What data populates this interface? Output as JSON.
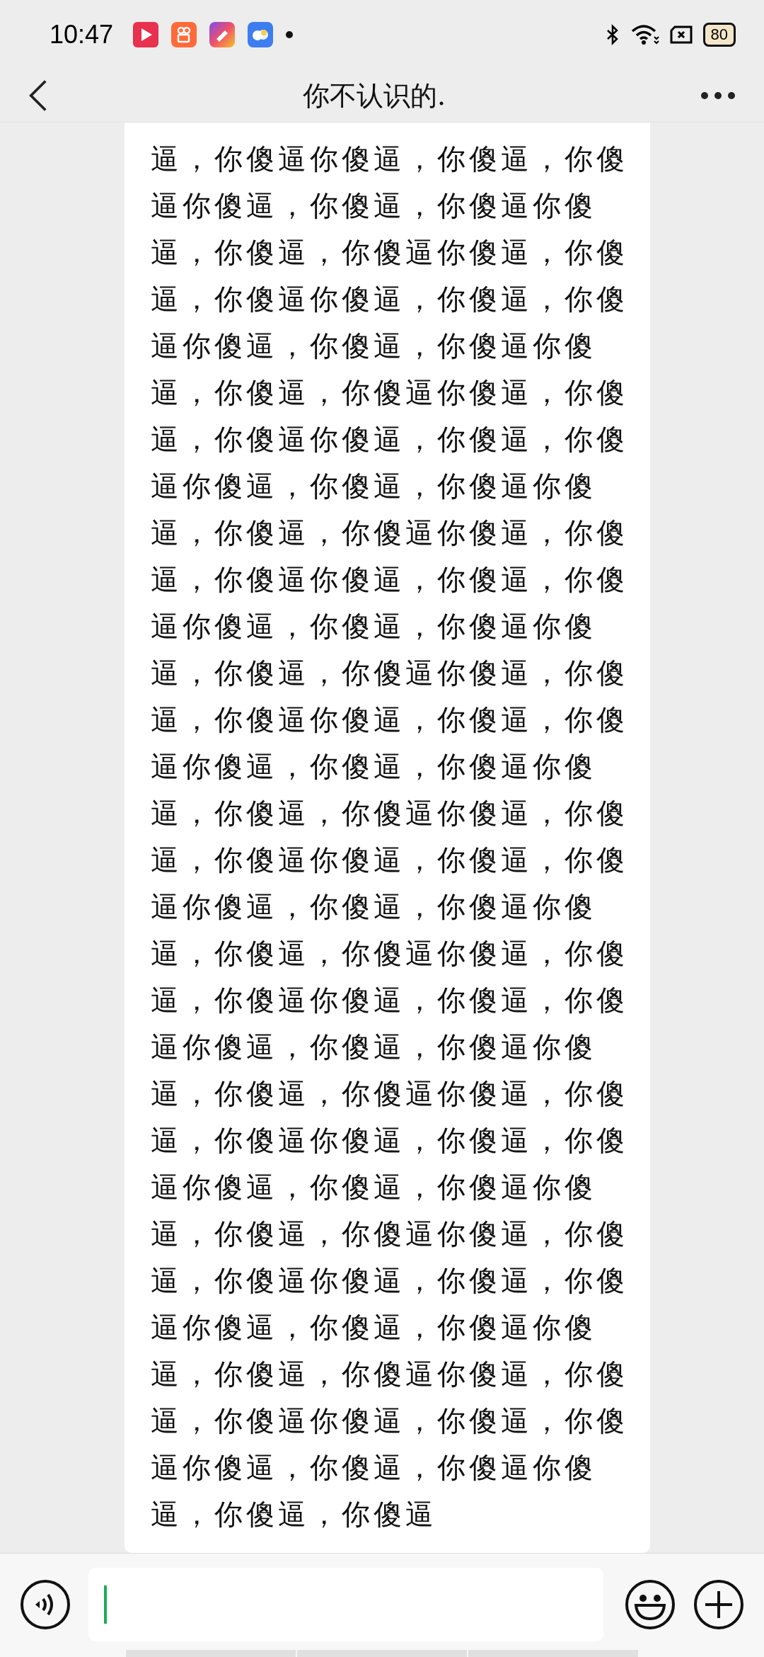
{
  "status_bar": {
    "time": "10:47",
    "battery": "80"
  },
  "header": {
    "title": "你不认识的."
  },
  "messages": [
    {
      "text": "逼，你傻逼你傻逼，你傻逼，你傻逼你傻逼，你傻逼，你傻逼你傻逼，你傻逼，你傻逼你傻逼，你傻逼，你傻逼你傻逼，你傻逼，你傻逼你傻逼，你傻逼，你傻逼你傻逼，你傻逼，你傻逼你傻逼，你傻逼，你傻逼你傻逼，你傻逼，你傻逼你傻逼，你傻逼，你傻逼你傻逼，你傻逼，你傻逼你傻逼，你傻逼，你傻逼你傻逼，你傻逼，你傻逼你傻逼，你傻逼，你傻逼你傻逼，你傻逼，你傻逼你傻逼，你傻逼，你傻逼你傻逼，你傻逼，你傻逼你傻逼，你傻逼，你傻逼你傻逼，你傻逼，你傻逼你傻逼，你傻逼，你傻逼你傻逼，你傻逼，你傻逼你傻逼，你傻逼，你傻逼你傻逼，你傻逼，你傻逼你傻逼，你傻逼，你傻逼你傻逼，你傻逼，你傻逼你傻逼，你傻逼，你傻逼你傻逼，你傻逼，你傻逼你傻逼，你傻逼，你傻逼你傻逼，你傻逼，你傻逼你傻逼，你傻逼，你傻逼你傻逼，你傻逼，你傻逼你傻逼，你傻逼，你傻逼你傻逼，你傻逼，你傻逼你傻逼，你傻逼，你傻逼你傻逼，你傻逼，你傻逼你傻逼，你傻逼，你傻逼你傻逼，你傻逼，你傻逼你傻逼，你傻逼，你傻逼你傻逼，你傻逼，你傻逼"
    }
  ]
}
